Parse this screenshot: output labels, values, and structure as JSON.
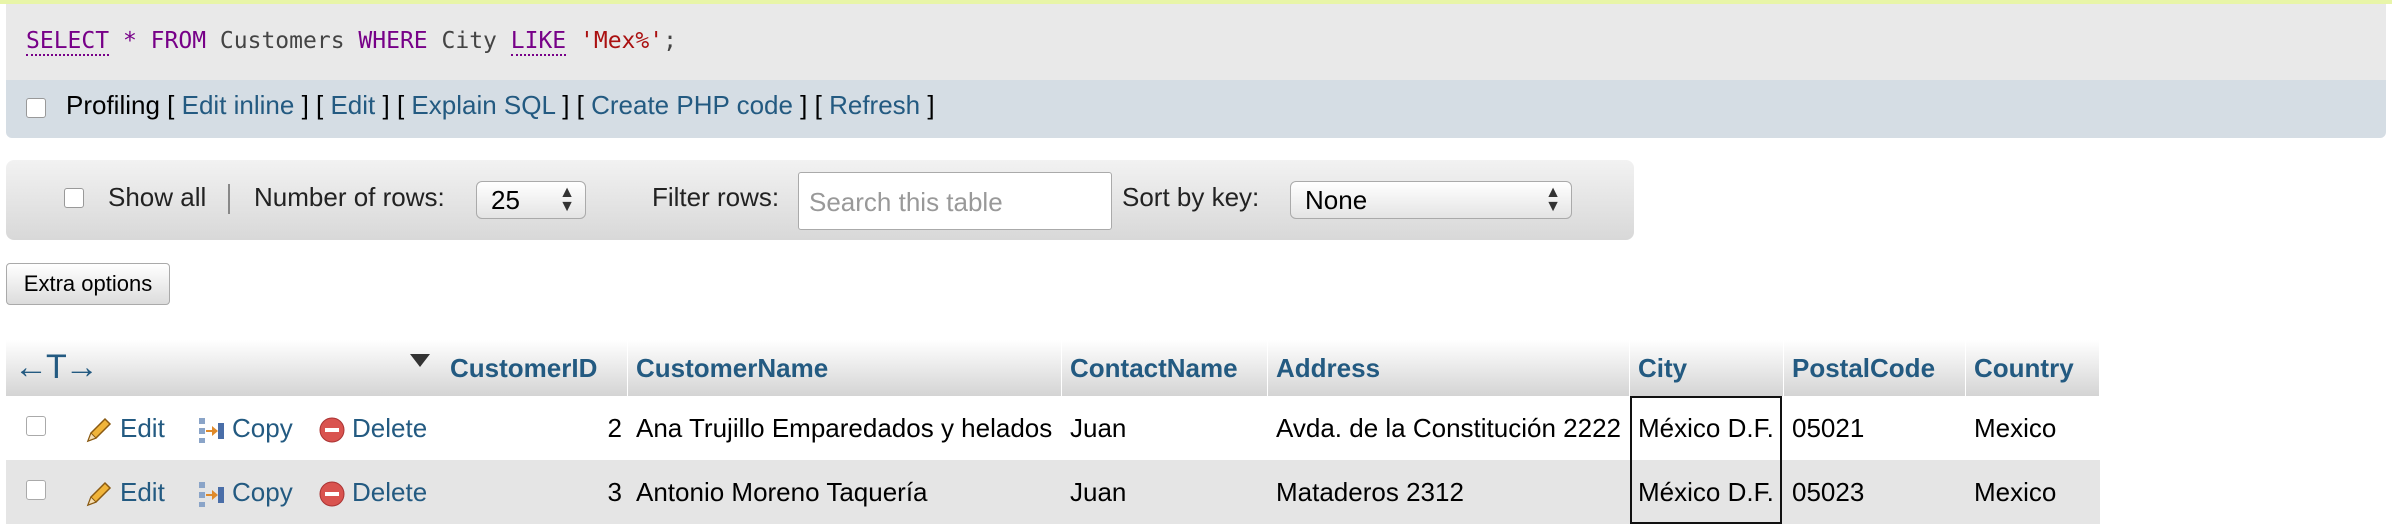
{
  "query": {
    "select": "SELECT",
    "star": "*",
    "from": "FROM",
    "table": "Customers",
    "where": "WHERE",
    "column": "City",
    "like": "LIKE",
    "pattern": "'Mex%'",
    "end": ";"
  },
  "profiling": {
    "label": "Profiling",
    "links": [
      "Edit inline",
      "Edit",
      "Explain SQL",
      "Create PHP code",
      "Refresh"
    ]
  },
  "navigation": {
    "show_all": "Show all",
    "rows_label": "Number of rows:",
    "rows_value": "25",
    "filter_label": "Filter rows:",
    "filter_placeholder": "Search this table",
    "sort_label": "Sort by key:",
    "sort_value": "None"
  },
  "extra_options": "Extra options",
  "table": {
    "control_arrows": "←T→",
    "columns": [
      "CustomerID",
      "CustomerName",
      "ContactName",
      "Address",
      "City",
      "PostalCode",
      "Country"
    ],
    "actions": {
      "edit": "Edit",
      "copy": "Copy",
      "delete": "Delete"
    },
    "rows": [
      {
        "CustomerID": "2",
        "CustomerName": "Ana Trujillo Emparedados y helados",
        "ContactName": "Juan",
        "Address": "Avda. de la Constitución 2222",
        "City": "México D.F.",
        "PostalCode": "05021",
        "Country": "Mexico"
      },
      {
        "CustomerID": "3",
        "CustomerName": "Antonio Moreno Taquería",
        "ContactName": "Juan",
        "Address": "Mataderos 2312",
        "City": "México D.F.",
        "PostalCode": "05023",
        "Country": "Mexico"
      }
    ]
  },
  "colors": {
    "link": "#235a81",
    "keyword": "#770088",
    "string": "#aa1111",
    "profiling_bg": "#d5dde4",
    "sql_bg": "#e9e9e9"
  }
}
